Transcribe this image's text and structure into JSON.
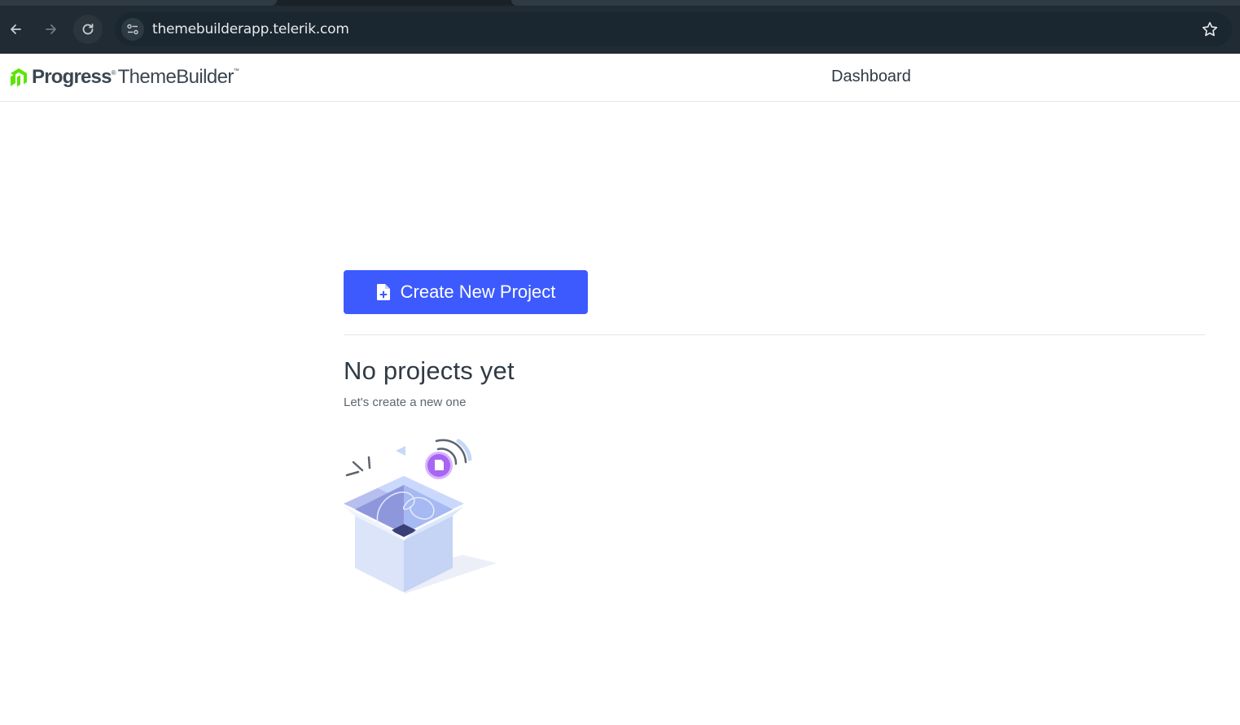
{
  "browser": {
    "url": "themebuilderapp.telerik.com",
    "icons": [
      "back-arrow-icon",
      "forward-arrow-icon",
      "reload-icon",
      "site-settings-icon",
      "bookmark-star-icon"
    ]
  },
  "header": {
    "logo_brand": "Progress",
    "logo_product": "ThemeBuilder",
    "nav_dashboard": "Dashboard"
  },
  "main": {
    "create_button_label": "Create New Project",
    "empty_title": "No projects yet",
    "empty_subtitle": "Let's create a new one"
  },
  "colors": {
    "primary": "#3d5afe",
    "chrome_bg": "#202b33",
    "logo_green": "#5ce500",
    "text_dark": "#303a44"
  }
}
